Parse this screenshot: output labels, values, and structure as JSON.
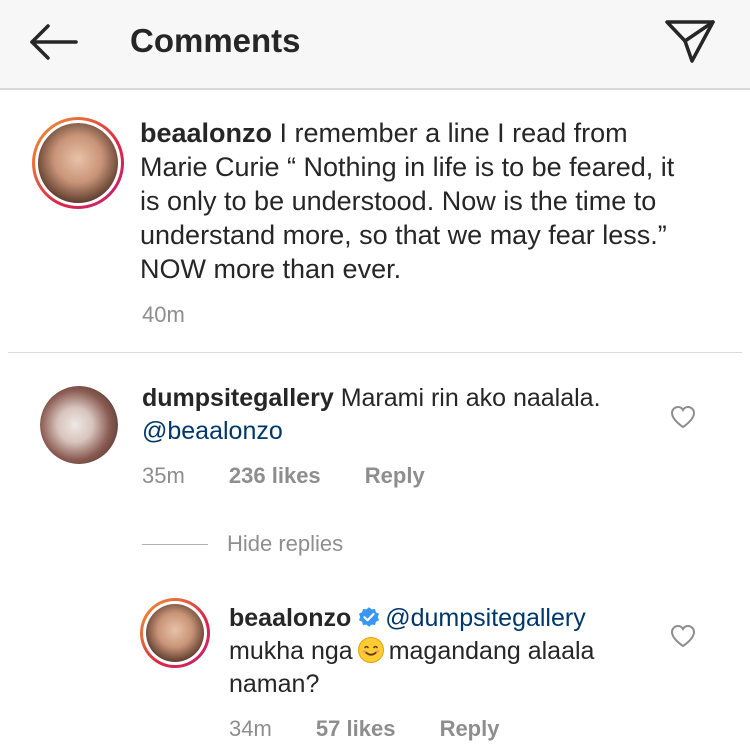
{
  "header": {
    "title": "Comments",
    "back_icon": "back-arrow-icon",
    "send_icon": "direct-send-icon"
  },
  "caption": {
    "username": "beaalonzo",
    "text": "I remember a line I read from Marie Curie “ Nothing in life is to be feared, it is only to be understood. Now is the time to understand more, so that we may fear less.” NOW more than ever.",
    "time": "40m"
  },
  "comments": [
    {
      "username": "dumpsitegallery",
      "text": "Marami rin ako naalala.",
      "mention": "@beaalonzo",
      "time": "35m",
      "likes": "236 likes",
      "reply_label": "Reply"
    }
  ],
  "replies_toggle": "Hide replies",
  "replies": [
    {
      "username": "beaalonzo",
      "verified": true,
      "mention": "@dumpsitegallery",
      "text_before_emoji": "mukha nga",
      "emoji": "smiling-face-emoji",
      "text_after_emoji": "magandang alaala naman?",
      "time": "34m",
      "likes": "57 likes",
      "reply_label": "Reply"
    }
  ],
  "colors": {
    "text": "#262626",
    "secondary": "#8e8e8e",
    "mention": "#00376b",
    "verified": "#3897f0"
  }
}
